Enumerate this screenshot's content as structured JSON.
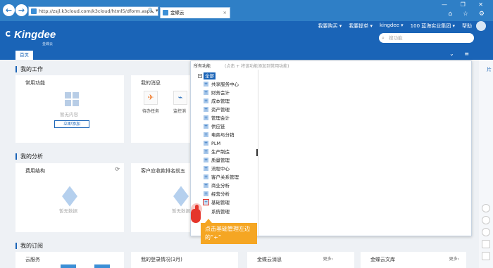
{
  "browser": {
    "back": "←",
    "forward": "→",
    "url": "http://zsjl.k3cloud.com/k3cloud/html5/dform.aspx",
    "address_tools": "🔍 ▾ ⟳",
    "tab_label": "金蝶云",
    "tab_close": "×",
    "window_controls": "— ❐ ✕",
    "toolbar_icons": "⌂ ☆ ⚙"
  },
  "header": {
    "logo": "Kingdee",
    "logo_sub": "金蝶云",
    "links": [
      "我要购买 ▾",
      "我要提单 ▾",
      "kingdee ▾",
      "100 蓝海实业集团 ▾",
      "帮助"
    ],
    "search_placeholder": "搜功能",
    "search_icon": "⌕"
  },
  "tabbar": {
    "home": "首页",
    "tools": "⌄ ≡"
  },
  "work": {
    "title": "我的工作",
    "common_functions": "常用功能",
    "no_content": "暂无内容",
    "add_now": "立即添加",
    "messages": "我的消息",
    "todo": "待办任务",
    "monitor": "监控消",
    "todo_icon": "✈",
    "monitor_icon": "⌁"
  },
  "analysis": {
    "title": "我的分析",
    "cost_structure": "费用结构",
    "receivable_top5": "客户应收款排名前五",
    "no_data": "暂无数据",
    "refresh_icon": "⟳"
  },
  "subscription": {
    "title": "我的订阅",
    "cloud_service": "云服务",
    "login_status": "我的登录情况(3月)",
    "kingdee_news": "金蝶云消息",
    "more": "更多›",
    "kingdee_library": "金蝶云文库"
  },
  "panel": {
    "title": "所有功能",
    "hint": "(点击 + 将该功能添加到常用功能)",
    "root_label": "全部",
    "root_toggle": "−",
    "items": [
      "共享服务中心",
      "财务会计",
      "成本管理",
      "资产管理",
      "管理会计",
      "供应链",
      "电商与分销",
      "PLM",
      "生产制造",
      "质量管理",
      "流程中心",
      "客户关系管理",
      "商业分析",
      "经营分析",
      "基础管理",
      "系统管理"
    ],
    "plus": "+"
  },
  "tooltip": {
    "text": "点击基础管理左边的“+”"
  },
  "right_rail": {
    "text": "片"
  }
}
